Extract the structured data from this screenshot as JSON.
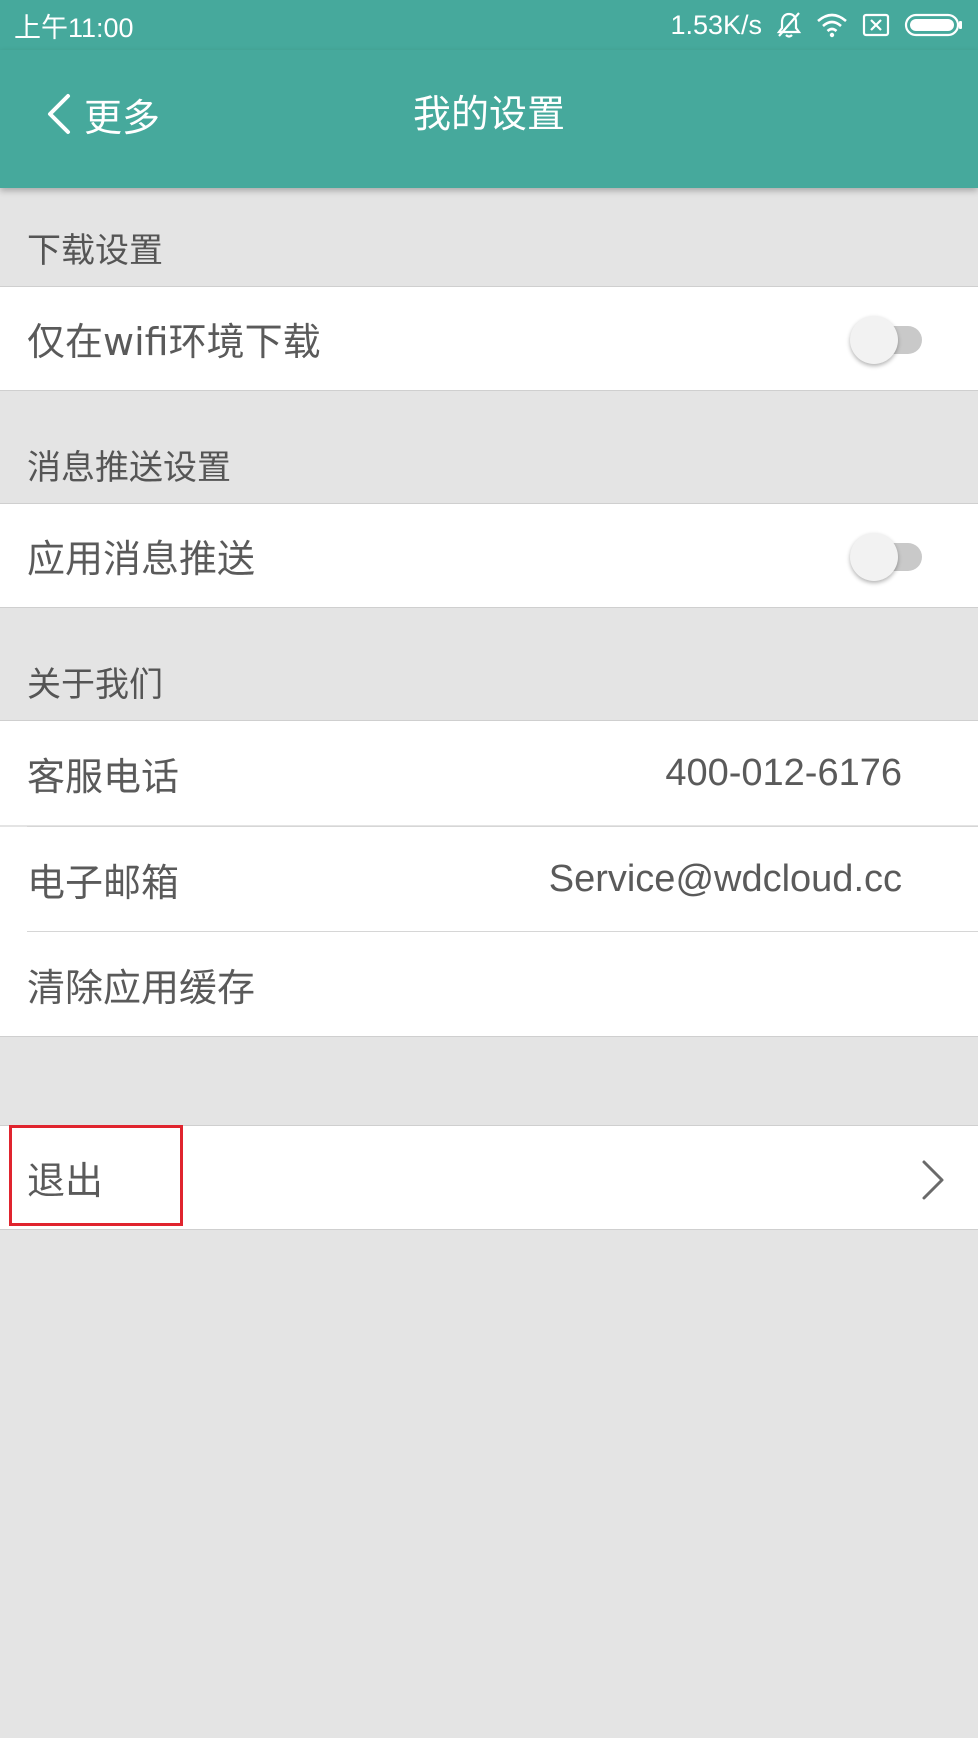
{
  "status_bar": {
    "time": "上午11:00",
    "net_speed": "1.53K/s",
    "icons": [
      "bell-muted-icon",
      "wifi-icon",
      "sim-x-icon",
      "battery-icon"
    ]
  },
  "app_bar": {
    "back_label": "更多",
    "title": "我的设置"
  },
  "sections": {
    "download": {
      "header": "下载设置",
      "wifi_only_label": "仅在wifi环境下载",
      "wifi_only_enabled": false
    },
    "push": {
      "header": "消息推送设置",
      "app_push_label": "应用消息推送",
      "app_push_enabled": false
    },
    "about": {
      "header": "关于我们",
      "phone_label": "客服电话",
      "phone_value": "400-012-6176",
      "email_label": "电子邮箱",
      "email_value": "Service@wdcloud.cc",
      "clear_cache_label": "清除应用缓存"
    }
  },
  "logout": {
    "label": "退出"
  },
  "colors": {
    "primary": "#46a99c",
    "background": "#e4e4e4",
    "highlight": "#e0242e"
  }
}
